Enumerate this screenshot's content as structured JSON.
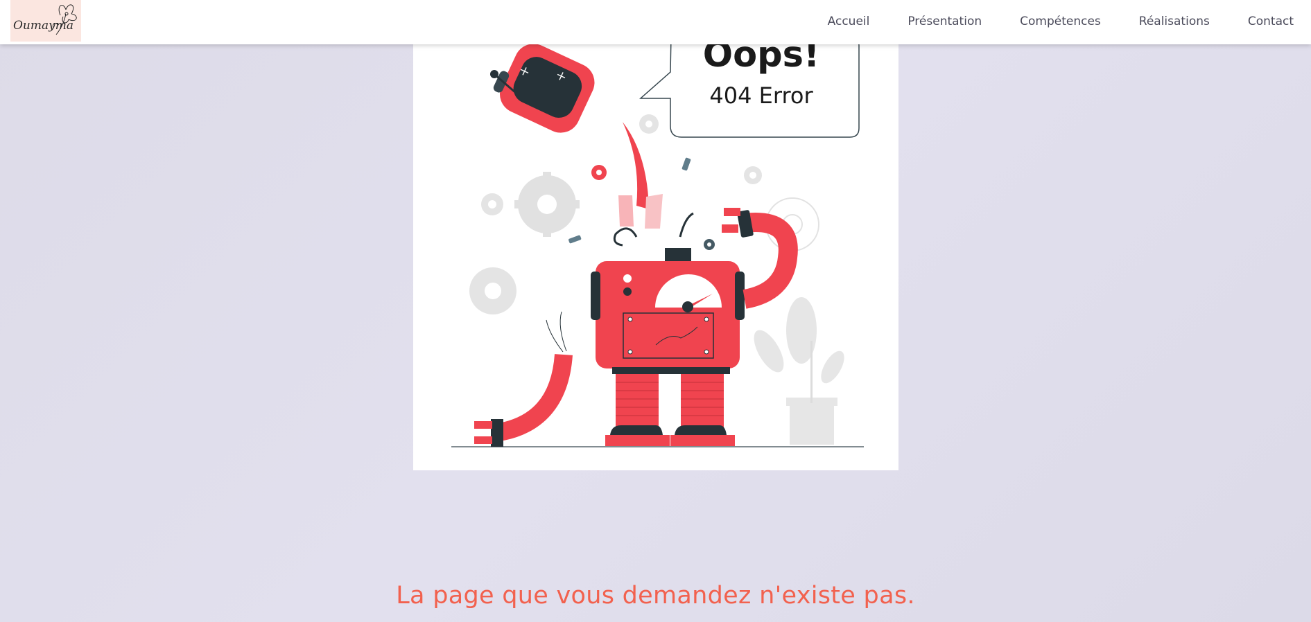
{
  "header": {
    "logo_text": "Oumayma",
    "nav": [
      {
        "label": "Accueil"
      },
      {
        "label": "Présentation"
      },
      {
        "label": "Compétences"
      },
      {
        "label": "Réalisations"
      },
      {
        "label": "Contact"
      }
    ]
  },
  "illustration": {
    "title": "Oops!",
    "subtitle": "404 Error"
  },
  "message": "La page que vous demandez n'existe pas.",
  "colors": {
    "accent": "#f2614e",
    "robot_red": "#f0444f",
    "robot_dark": "#263238",
    "background": "#e0deeb"
  }
}
